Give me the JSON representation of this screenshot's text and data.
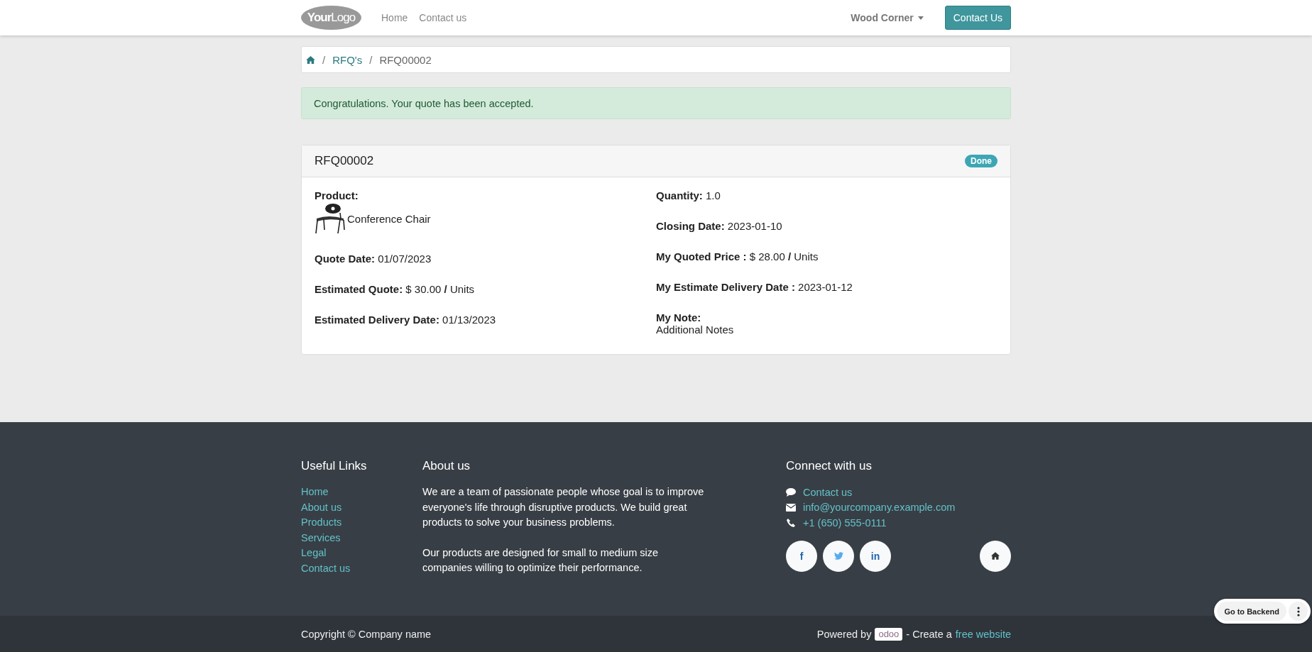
{
  "header": {
    "logo": {
      "part1": "Your",
      "part2": "Logo"
    },
    "nav": [
      "Home",
      "Contact us"
    ],
    "user_menu": "Wood Corner",
    "cta": "Contact Us"
  },
  "breadcrumb": {
    "separator": "/",
    "items": [
      "RFQ's"
    ],
    "current": "RFQ00002"
  },
  "alert": "Congratulations. Your quote has been accepted.",
  "card": {
    "title": "RFQ00002",
    "status": "Done",
    "left": [
      {
        "kind": "product",
        "label": "Product:",
        "value": "Conference Chair"
      },
      {
        "kind": "field",
        "label": "Quote Date:",
        "value": "01/07/2023"
      },
      {
        "kind": "field",
        "label": "Estimated Quote:",
        "value": "$ 30.00 **/** Units"
      },
      {
        "kind": "field",
        "label": "Estimated Delivery Date:",
        "value": "01/13/2023"
      }
    ],
    "right": [
      {
        "kind": "field",
        "label": "Quantity:",
        "value": "1.0"
      },
      {
        "kind": "field",
        "label": "Closing Date:",
        "value": "2023-01-10"
      },
      {
        "kind": "field",
        "label": "My Quoted Price :",
        "value": "$ 28.00 **/** Units"
      },
      {
        "kind": "field",
        "label": "My Estimate Delivery Date :",
        "value": "2023-01-12"
      },
      {
        "kind": "note",
        "label": "My Note:",
        "value": "Additional Notes"
      }
    ]
  },
  "footer": {
    "links_title": "Useful Links",
    "links": [
      "Home",
      "About us",
      "Products",
      "Services",
      "Legal",
      "Contact us"
    ],
    "about_title": "About us",
    "about": [
      "We are a team of passionate people whose goal is to improve everyone's life through disruptive products. We build great products to solve your business problems.",
      "Our products are designed for small to medium size companies willing to optimize their performance."
    ],
    "connect_title": "Connect with us",
    "contacts": [
      {
        "kind": "chat",
        "text": "Contact us"
      },
      {
        "kind": "mail",
        "text": "info@yourcompany.example.com"
      },
      {
        "kind": "phone",
        "text": "+1 (650) 555-0111"
      }
    ],
    "social": [
      {
        "kind": "facebook",
        "text": "f"
      },
      {
        "kind": "twitter"
      },
      {
        "kind": "linkedin",
        "text": "in"
      }
    ]
  },
  "bottom": {
    "copyright": "Copyright © Company name",
    "powered": "Powered by",
    "brand": "odoo",
    "create": "- Create a",
    "link": "free website"
  },
  "backend_button": "Go to Backend"
}
